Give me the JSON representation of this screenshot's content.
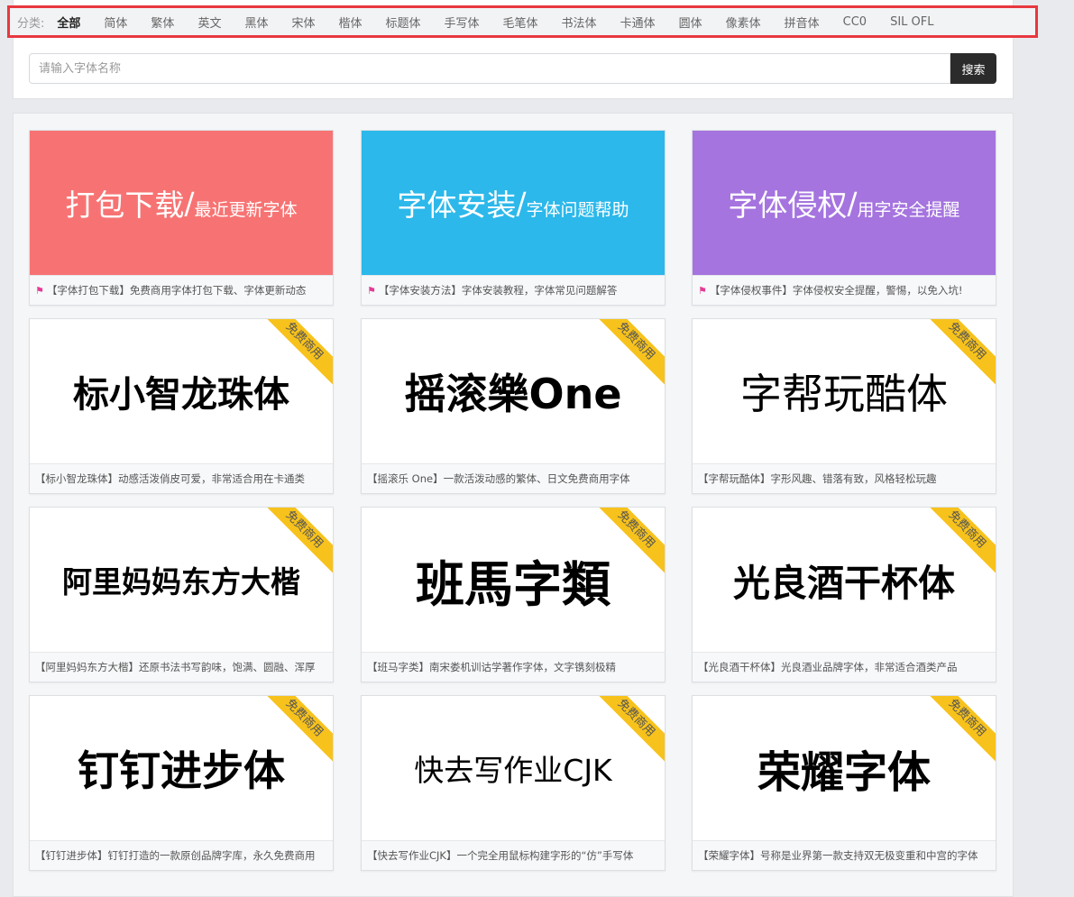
{
  "categories": {
    "label": "分类:",
    "items": [
      "全部",
      "简体",
      "繁体",
      "英文",
      "黑体",
      "宋体",
      "楷体",
      "标题体",
      "手写体",
      "毛笔体",
      "书法体",
      "卡通体",
      "圆体",
      "像素体",
      "拼音体",
      "CC0",
      "SIL OFL"
    ]
  },
  "search": {
    "placeholder": "请输入字体名称",
    "button": "搜索"
  },
  "colors": {
    "banner1": "#f77373",
    "banner2": "#2cb8ea",
    "banner3": "#a574df",
    "ribbon": "#f7c21c",
    "highlight_border": "#e8383f"
  },
  "banners": [
    {
      "big": "打包下载",
      "small": "最近更新字体",
      "caption": "【字体打包下载】免费商用字体打包下载、字体更新动态"
    },
    {
      "big": "字体安装",
      "small": "字体问题帮助",
      "caption": "【字体安装方法】字体安装教程，字体常见问题解答"
    },
    {
      "big": "字体侵权",
      "small": "用字安全提醒",
      "caption": "【字体侵权事件】字体侵权安全提醒，警惕，以免入坑!"
    }
  ],
  "ribbon_text": "免费商用",
  "fonts": [
    {
      "preview": "标小智龙珠体",
      "caption": "【标小智龙珠体】动感活泼俏皮可爱，非常适合用在卡通类"
    },
    {
      "preview": "摇滚樂One",
      "caption": "【摇滚乐 One】一款活泼动感的繁体、日文免费商用字体"
    },
    {
      "preview": "字帮玩酷体",
      "caption": "【字帮玩酷体】字形风趣、错落有致，风格轻松玩趣"
    },
    {
      "preview": "阿里妈妈东方大楷",
      "caption": "【阿里妈妈东方大楷】还原书法书写韵味，饱满、圆融、浑厚"
    },
    {
      "preview": "班馬字類",
      "caption": "【班马字类】南宋娄机训诂学著作字体，文字镌刻极精"
    },
    {
      "preview": "光良酒干杯体",
      "caption": "【光良酒干杯体】光良酒业品牌字体，非常适合酒类产品"
    },
    {
      "preview": "钉钉进步体",
      "caption": "【钉钉进步体】钉钉打造的一款原创品牌字库，永久免费商用"
    },
    {
      "preview": "快去写作业CJK",
      "caption": "【快去写作业CJK】一个完全用鼠标构建字形的“仿”手写体"
    },
    {
      "preview": "荣耀字体",
      "caption": "【荣耀字体】号称是业界第一款支持双无极变重和中宫的字体"
    }
  ]
}
